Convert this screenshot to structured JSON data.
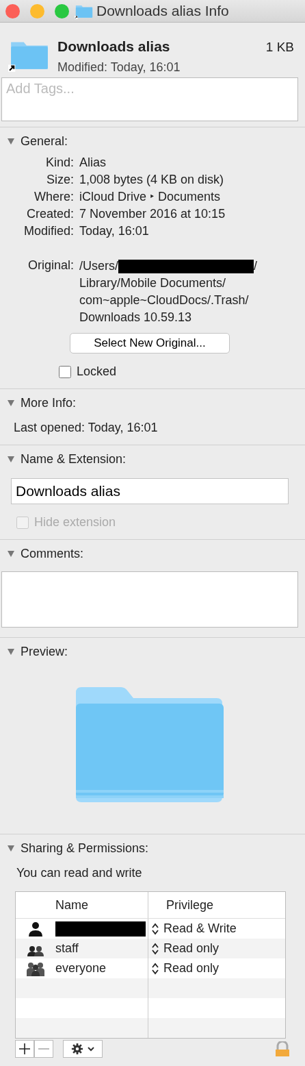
{
  "window": {
    "title": "Downloads alias Info"
  },
  "header": {
    "name": "Downloads alias",
    "size": "1 KB",
    "modified_label": "Modified:",
    "modified": "Today, 16:01"
  },
  "tags": {
    "placeholder": "Add Tags..."
  },
  "sections": [
    {
      "kind": "general",
      "title": "General:",
      "expanded": true,
      "rows": [
        {
          "label": "Kind:",
          "value": "Alias"
        },
        {
          "label": "Size:",
          "value": "1,008 bytes (4 KB on disk)"
        },
        {
          "label": "Where:",
          "value": "iCloud Drive ‣ Documents"
        },
        {
          "label": "Created:",
          "value": "7 November 2016 at 10:15"
        },
        {
          "label": "Modified:",
          "value": "Today, 16:01"
        }
      ],
      "original": {
        "label": "Original:",
        "first_line_end": "/",
        "lines": [
          "/Users/",
          "Library/Mobile Documents/",
          "com~apple~CloudDocs/.Trash/",
          "Downloads 10.59.13"
        ]
      },
      "button": "Select New Original...",
      "locked": {
        "label": "Locked",
        "checked": false
      }
    },
    {
      "kind": "more",
      "title": "More Info:",
      "expanded": true,
      "rows": [
        {
          "label": "Last opened:",
          "value": "Today, 16:01"
        }
      ]
    },
    {
      "kind": "name",
      "title": "Name & Extension:",
      "expanded": true,
      "value": "Downloads alias",
      "hide": {
        "label": "Hide extension",
        "checked": false,
        "disabled": true
      }
    },
    {
      "kind": "comments",
      "title": "Comments:",
      "expanded": true
    },
    {
      "kind": "preview",
      "title": "Preview:",
      "expanded": true
    },
    {
      "kind": "sharing",
      "title": "Sharing & Permissions:",
      "expanded": true,
      "note": "You can read and write",
      "columns": [
        "Name",
        "Privilege"
      ],
      "rows": [
        {
          "kind": "user",
          "redacted": true,
          "privilege": "Read & Write"
        },
        {
          "kind": "group",
          "name": "staff",
          "privilege": "Read only"
        },
        {
          "kind": "everyone",
          "name": "everyone",
          "privilege": "Read only"
        }
      ]
    }
  ]
}
